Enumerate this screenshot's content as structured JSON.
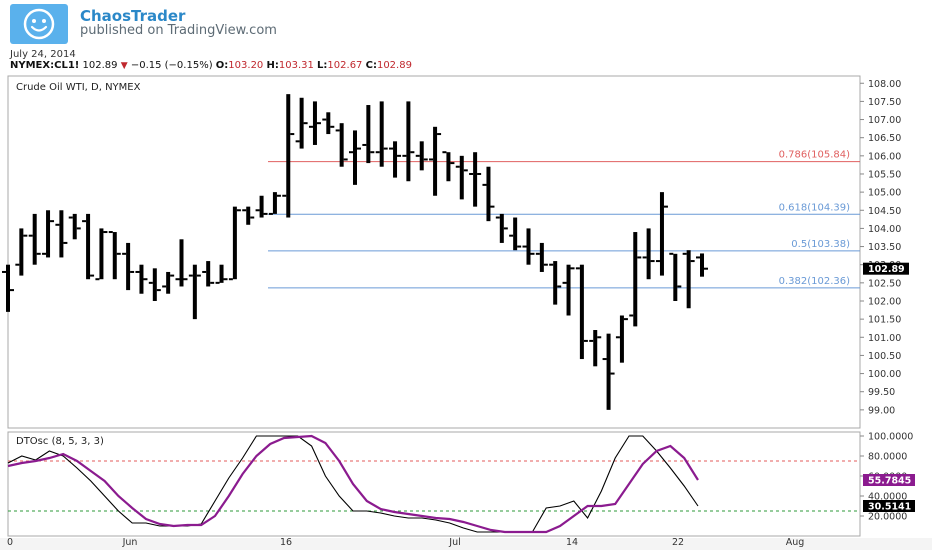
{
  "header": {
    "author": "ChaosTrader",
    "publisher": "published on TradingView.com",
    "date": "July 24, 2014"
  },
  "quote": {
    "symbol": "NYMEX:CL1!",
    "last": "102.89",
    "change": "−0.15 (−0.15%)",
    "o_label": "O:",
    "o": "103.20",
    "h_label": "H:",
    "h": "103.31",
    "l_label": "L:",
    "l": "102.67",
    "c_label": "C:",
    "c": "102.89"
  },
  "colors": {
    "bars": "#000000",
    "fib_red": "#e06060",
    "fib_blue": "#6a9ad6",
    "fast_line": "#000000",
    "slow_line": "#8b1b8f",
    "up_level": "#e35b5b",
    "down_level": "#2e9a3a"
  },
  "chart_data": [
    {
      "type": "ohlc",
      "title": "Crude Oil WTI, D, NYMEX",
      "ylim": [
        98.5,
        108.2
      ],
      "y_ticks": [
        "108.00",
        "107.50",
        "107.00",
        "106.50",
        "106.00",
        "105.50",
        "105.00",
        "104.50",
        "104.00",
        "103.50",
        "103.00",
        "102.50",
        "102.00",
        "101.50",
        "101.00",
        "100.50",
        "100.00",
        "99.50",
        "99.00"
      ],
      "last_price_label": "102.89",
      "x_tick_labels": [
        "0",
        "Jun",
        "16",
        "Jul",
        "14",
        "22",
        "Aug"
      ],
      "bars": [
        {
          "o": 102.8,
          "h": 103.0,
          "l": 101.7,
          "c": 102.3
        },
        {
          "o": 103.0,
          "h": 104.0,
          "l": 102.7,
          "c": 103.8
        },
        {
          "o": 103.8,
          "h": 104.4,
          "l": 103.0,
          "c": 103.3
        },
        {
          "o": 103.3,
          "h": 104.5,
          "l": 103.2,
          "c": 104.2
        },
        {
          "o": 104.1,
          "h": 104.5,
          "l": 103.2,
          "c": 103.6
        },
        {
          "o": 104.3,
          "h": 104.4,
          "l": 103.7,
          "c": 104.0
        },
        {
          "o": 104.2,
          "h": 104.4,
          "l": 102.6,
          "c": 102.7
        },
        {
          "o": 102.6,
          "h": 104.0,
          "l": 102.6,
          "c": 103.9
        },
        {
          "o": 103.9,
          "h": 103.9,
          "l": 102.6,
          "c": 103.3
        },
        {
          "o": 103.3,
          "h": 103.6,
          "l": 102.3,
          "c": 102.8
        },
        {
          "o": 102.8,
          "h": 103.0,
          "l": 102.2,
          "c": 102.6
        },
        {
          "o": 102.5,
          "h": 102.9,
          "l": 102.0,
          "c": 102.3
        },
        {
          "o": 102.4,
          "h": 102.8,
          "l": 102.2,
          "c": 102.7
        },
        {
          "o": 102.6,
          "h": 103.7,
          "l": 102.4,
          "c": 102.6
        },
        {
          "o": 102.7,
          "h": 103.0,
          "l": 101.5,
          "c": 102.7
        },
        {
          "o": 102.8,
          "h": 103.1,
          "l": 102.4,
          "c": 102.5
        },
        {
          "o": 102.5,
          "h": 103.0,
          "l": 102.5,
          "c": 102.6
        },
        {
          "o": 102.6,
          "h": 104.6,
          "l": 102.6,
          "c": 104.5
        },
        {
          "o": 104.5,
          "h": 104.6,
          "l": 104.1,
          "c": 104.3
        },
        {
          "o": 104.5,
          "h": 104.9,
          "l": 104.3,
          "c": 104.4
        },
        {
          "o": 104.4,
          "h": 105.0,
          "l": 104.4,
          "c": 104.9
        },
        {
          "o": 104.9,
          "h": 107.7,
          "l": 104.3,
          "c": 106.6
        },
        {
          "o": 106.4,
          "h": 107.6,
          "l": 106.2,
          "c": 106.9
        },
        {
          "o": 106.8,
          "h": 107.5,
          "l": 106.3,
          "c": 106.9
        },
        {
          "o": 107.0,
          "h": 107.2,
          "l": 106.6,
          "c": 106.8
        },
        {
          "o": 106.7,
          "h": 106.9,
          "l": 105.7,
          "c": 105.9
        },
        {
          "o": 106.1,
          "h": 106.7,
          "l": 105.2,
          "c": 106.2
        },
        {
          "o": 106.3,
          "h": 107.4,
          "l": 105.8,
          "c": 106.1
        },
        {
          "o": 106.1,
          "h": 107.5,
          "l": 105.7,
          "c": 106.2
        },
        {
          "o": 106.2,
          "h": 106.4,
          "l": 105.4,
          "c": 106.0
        },
        {
          "o": 106.0,
          "h": 107.5,
          "l": 105.3,
          "c": 106.1
        },
        {
          "o": 106.0,
          "h": 106.4,
          "l": 105.6,
          "c": 105.9
        },
        {
          "o": 105.9,
          "h": 106.8,
          "l": 104.9,
          "c": 106.6
        },
        {
          "o": 106.1,
          "h": 106.1,
          "l": 105.3,
          "c": 105.8
        },
        {
          "o": 105.7,
          "h": 106.0,
          "l": 104.8,
          "c": 105.6
        },
        {
          "o": 105.5,
          "h": 106.1,
          "l": 104.6,
          "c": 105.5
        },
        {
          "o": 105.2,
          "h": 105.7,
          "l": 104.2,
          "c": 104.6
        },
        {
          "o": 104.3,
          "h": 104.4,
          "l": 103.6,
          "c": 104.0
        },
        {
          "o": 103.8,
          "h": 104.3,
          "l": 103.4,
          "c": 103.5
        },
        {
          "o": 103.5,
          "h": 104.0,
          "l": 103.0,
          "c": 103.3
        },
        {
          "o": 103.3,
          "h": 103.6,
          "l": 102.8,
          "c": 103.0
        },
        {
          "o": 103.0,
          "h": 103.1,
          "l": 101.9,
          "c": 102.4
        },
        {
          "o": 102.5,
          "h": 103.0,
          "l": 101.6,
          "c": 102.9
        },
        {
          "o": 102.9,
          "h": 103.0,
          "l": 100.4,
          "c": 100.9
        },
        {
          "o": 100.9,
          "h": 101.2,
          "l": 100.2,
          "c": 101.0
        },
        {
          "o": 100.4,
          "h": 101.1,
          "l": 99.0,
          "c": 100.0
        },
        {
          "o": 101.0,
          "h": 101.6,
          "l": 100.3,
          "c": 101.5
        },
        {
          "o": 101.6,
          "h": 103.9,
          "l": 101.3,
          "c": 103.2
        },
        {
          "o": 103.2,
          "h": 104.0,
          "l": 102.6,
          "c": 103.1
        },
        {
          "o": 103.1,
          "h": 105.0,
          "l": 102.7,
          "c": 104.6
        },
        {
          "o": 103.3,
          "h": 103.3,
          "l": 102.0,
          "c": 102.4
        },
        {
          "o": 103.3,
          "h": 103.4,
          "l": 101.8,
          "c": 103.1
        },
        {
          "o": 103.2,
          "h": 103.31,
          "l": 102.67,
          "c": 102.89
        }
      ],
      "fib_levels": [
        {
          "label": "0.786(105.84)",
          "value": 105.84,
          "color": "red"
        },
        {
          "label": "0.618(104.39)",
          "value": 104.39,
          "color": "blue"
        },
        {
          "label": "0.5(103.38)",
          "value": 103.38,
          "color": "blue"
        },
        {
          "label": "0.382(102.36)",
          "value": 102.36,
          "color": "blue"
        }
      ]
    },
    {
      "type": "line",
      "title": "DTOsc (8, 5, 3, 3)",
      "ylim": [
        0,
        104
      ],
      "y_ticks": [
        "100.0000",
        "80.0000",
        "60.0000",
        "40.0000",
        "20.0000"
      ],
      "levels": [
        75,
        25
      ],
      "value_labels": [
        "55.7845",
        "30.5141"
      ],
      "series": [
        {
          "values": [
            73,
            80,
            76,
            85,
            80,
            68,
            55,
            40,
            25,
            13,
            13,
            10,
            10,
            10,
            12,
            35,
            58,
            78,
            100,
            100,
            100,
            100,
            90,
            60,
            40,
            25,
            25,
            23,
            20,
            18,
            18,
            16,
            13,
            8,
            4,
            4,
            4,
            4,
            4,
            28,
            30,
            35,
            18,
            45,
            78,
            100,
            100,
            85,
            68,
            50,
            30
          ]
        },
        {
          "values": [
            70,
            73,
            75,
            78,
            82,
            75,
            65,
            55,
            40,
            28,
            17,
            12,
            10,
            11,
            11,
            20,
            40,
            62,
            80,
            92,
            98,
            99,
            100,
            93,
            75,
            52,
            35,
            27,
            24,
            22,
            20,
            18,
            17,
            14,
            10,
            6,
            4,
            4,
            4,
            4,
            10,
            20,
            30,
            30,
            32,
            52,
            72,
            85,
            90,
            78,
            56
          ]
        }
      ]
    }
  ]
}
